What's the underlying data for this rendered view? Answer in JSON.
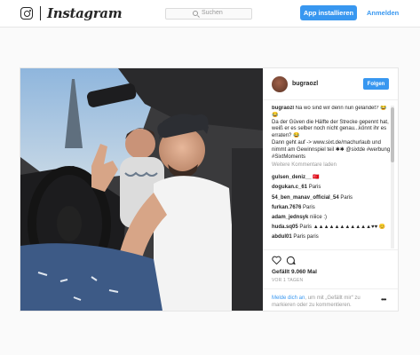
{
  "header": {
    "logo_text": "Instagram",
    "search_placeholder": "Suchen",
    "install_label": "App installieren",
    "login_label": "Anmelden"
  },
  "post": {
    "username": "bugraozl",
    "follow_label": "Folgen",
    "caption_user": "bugraozl",
    "caption_text": "Na wo sind wir denn nun gelandet? 😂😂\nDa der Güven die Hälfte der Strecke gepennt hat, weiß er es selber noch nicht genau...könnt ihr es erraten? 😂\nDann geht auf -> www.sixt.de/machurlaub und nimmt am Gewinnspiel teil ✱✱ @sixtde #werbung #SixtMoments",
    "more_comments": "Weitere Kommentare laden",
    "comments": [
      {
        "user": "gulsen_deniz__",
        "text": "🇹🇷"
      },
      {
        "user": "dogukan.c_61",
        "text": "Paris"
      },
      {
        "user": "54_ben_manav_official_54",
        "text": "Paris"
      },
      {
        "user": "furkan.7676",
        "text": "Paris"
      },
      {
        "user": "adam_jednsyk",
        "text": "niiice :)"
      },
      {
        "user": "huda.sq05",
        "text": "Paris ▲▲▲▲▲▲▲▲▲▲▲♥♥ 😊"
      },
      {
        "user": "abdul01",
        "text": "Paris paris"
      }
    ],
    "likes": "Gefällt 9.060 Mal",
    "time": "VOR 1 TAGEN",
    "login_prefix": "Melde dich an",
    "login_suffix": ", um mit „Gefällt mir“ zu markieren oder zu kommentieren.",
    "more_icon": "•••"
  },
  "colors": {
    "accent": "#3897f0",
    "background": "#fafafa",
    "border": "#e6e6e6"
  }
}
